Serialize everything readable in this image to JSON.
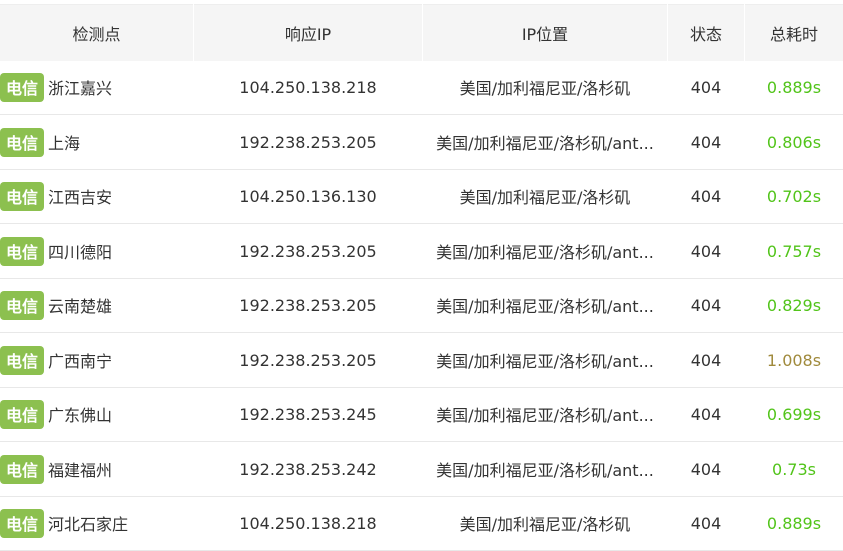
{
  "colors": {
    "ok": "#52c41a",
    "slow": "#a08a3c",
    "badge": "#8cc04f"
  },
  "header": {
    "point": "检测点",
    "ip": "响应IP",
    "location": "IP位置",
    "status": "状态",
    "time": "总耗时"
  },
  "rows": [
    {
      "isp": "电信",
      "point": "浙江嘉兴",
      "ip": "104.250.138.218",
      "location": "美国/加利福尼亚/洛杉矶",
      "status": "404",
      "time": "0.889s",
      "slow": false
    },
    {
      "isp": "电信",
      "point": "上海",
      "ip": "192.238.253.205",
      "location": "美国/加利福尼亚/洛杉矶/ant...",
      "status": "404",
      "time": "0.806s",
      "slow": false
    },
    {
      "isp": "电信",
      "point": "江西吉安",
      "ip": "104.250.136.130",
      "location": "美国/加利福尼亚/洛杉矶",
      "status": "404",
      "time": "0.702s",
      "slow": false
    },
    {
      "isp": "电信",
      "point": "四川德阳",
      "ip": "192.238.253.205",
      "location": "美国/加利福尼亚/洛杉矶/ant...",
      "status": "404",
      "time": "0.757s",
      "slow": false
    },
    {
      "isp": "电信",
      "point": "云南楚雄",
      "ip": "192.238.253.205",
      "location": "美国/加利福尼亚/洛杉矶/ant...",
      "status": "404",
      "time": "0.829s",
      "slow": false
    },
    {
      "isp": "电信",
      "point": "广西南宁",
      "ip": "192.238.253.205",
      "location": "美国/加利福尼亚/洛杉矶/ant...",
      "status": "404",
      "time": "1.008s",
      "slow": true
    },
    {
      "isp": "电信",
      "point": "广东佛山",
      "ip": "192.238.253.245",
      "location": "美国/加利福尼亚/洛杉矶/ant...",
      "status": "404",
      "time": "0.699s",
      "slow": false
    },
    {
      "isp": "电信",
      "point": "福建福州",
      "ip": "192.238.253.242",
      "location": "美国/加利福尼亚/洛杉矶/ant...",
      "status": "404",
      "time": "0.73s",
      "slow": false
    },
    {
      "isp": "电信",
      "point": "河北石家庄",
      "ip": "104.250.138.218",
      "location": "美国/加利福尼亚/洛杉矶",
      "status": "404",
      "time": "0.889s",
      "slow": false
    }
  ]
}
